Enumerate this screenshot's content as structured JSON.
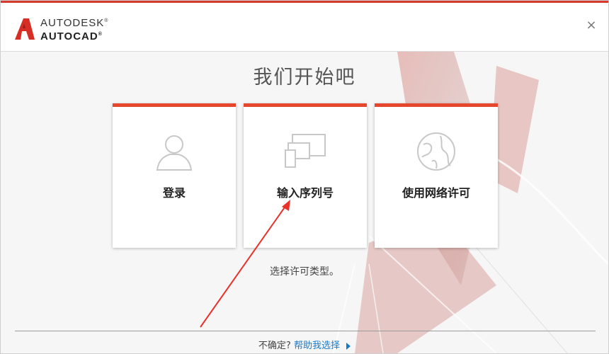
{
  "header": {
    "brand": "AUTODESK",
    "brand_mark": "®",
    "product": "AUTOCAD",
    "product_mark": "®",
    "close_label": "×"
  },
  "main": {
    "title": "我们开始吧",
    "cards": [
      {
        "label": "登录",
        "icon": "user-icon"
      },
      {
        "label": "输入序列号",
        "icon": "devices-icon"
      },
      {
        "label": "使用网络许可",
        "icon": "network-globe-icon"
      }
    ],
    "subtitle": "选择许可类型。"
  },
  "footer": {
    "question": "不确定?",
    "help_link": "帮助我选择"
  },
  "colors": {
    "accent": "#e5462d",
    "link": "#1a79c6",
    "annotation_arrow": "#e8322a"
  }
}
